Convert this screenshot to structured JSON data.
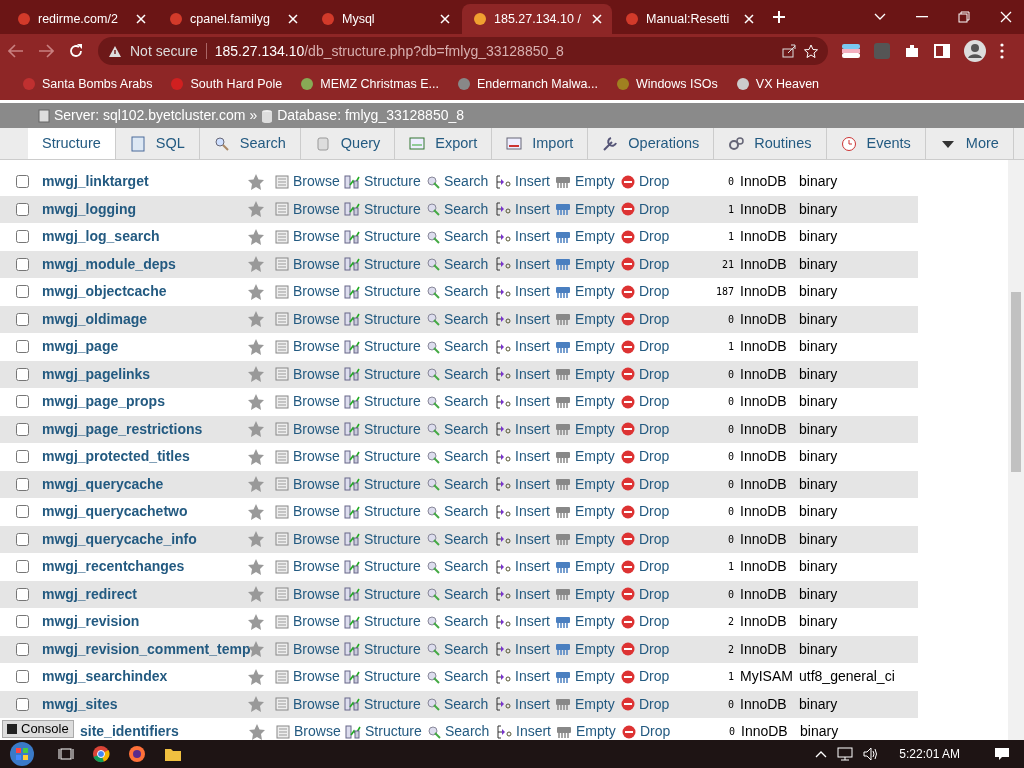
{
  "browser": {
    "tabs": [
      {
        "title": "redirme.com/2",
        "selected": false
      },
      {
        "title": "cpanel.familyg",
        "selected": false
      },
      {
        "title": "Mysql",
        "selected": false
      },
      {
        "title": "185.27.134.10 /",
        "selected": true
      },
      {
        "title": "Manual:Resetti",
        "selected": false
      }
    ],
    "security": "Not secure",
    "url_host": "185.27.134.10",
    "url_path": "/db_structure.php?db=fmlyg_33128850_8",
    "bookmarks": [
      "Santa Bombs Arabs",
      "South Hard Pole",
      "MEMZ Christmas E...",
      "Endermanch Malwa...",
      "Windows ISOs",
      "VX Heaven"
    ]
  },
  "breadcrumb": {
    "server": "Server: sql102.byetcluster.com",
    "separator": "»",
    "database": "Database: fmlyg_33128850_8"
  },
  "menu": [
    {
      "label": "Structure",
      "selected": true
    },
    {
      "label": "SQL",
      "selected": false
    },
    {
      "label": "Search",
      "selected": false
    },
    {
      "label": "Query",
      "selected": false
    },
    {
      "label": "Export",
      "selected": false
    },
    {
      "label": "Import",
      "selected": false
    },
    {
      "label": "Operations",
      "selected": false
    },
    {
      "label": "Routines",
      "selected": false
    },
    {
      "label": "Events",
      "selected": false
    },
    {
      "label": "More",
      "selected": false
    }
  ],
  "rows": [
    {
      "checked": false,
      "name": "mwgj_linktarget",
      "actions": [
        "Browse",
        "Structure",
        "Search",
        "Insert",
        "Empty",
        "Drop"
      ],
      "rows": "0",
      "engine": "InnoDB",
      "collation": "binary",
      "has_rows": false
    },
    {
      "checked": false,
      "name": "mwgj_logging",
      "actions": [
        "Browse",
        "Structure",
        "Search",
        "Insert",
        "Empty",
        "Drop"
      ],
      "rows": "1",
      "engine": "InnoDB",
      "collation": "binary",
      "has_rows": true
    },
    {
      "checked": false,
      "name": "mwgj_log_search",
      "actions": [
        "Browse",
        "Structure",
        "Search",
        "Insert",
        "Empty",
        "Drop"
      ],
      "rows": "1",
      "engine": "InnoDB",
      "collation": "binary",
      "has_rows": true
    },
    {
      "checked": false,
      "name": "mwgj_module_deps",
      "actions": [
        "Browse",
        "Structure",
        "Search",
        "Insert",
        "Empty",
        "Drop"
      ],
      "rows": "21",
      "engine": "InnoDB",
      "collation": "binary",
      "has_rows": true
    },
    {
      "checked": false,
      "name": "mwgj_objectcache",
      "actions": [
        "Browse",
        "Structure",
        "Search",
        "Insert",
        "Empty",
        "Drop"
      ],
      "rows": "187",
      "engine": "InnoDB",
      "collation": "binary",
      "has_rows": true
    },
    {
      "checked": false,
      "name": "mwgj_oldimage",
      "actions": [
        "Browse",
        "Structure",
        "Search",
        "Insert",
        "Empty",
        "Drop"
      ],
      "rows": "0",
      "engine": "InnoDB",
      "collation": "binary",
      "has_rows": false
    },
    {
      "checked": false,
      "name": "mwgj_page",
      "actions": [
        "Browse",
        "Structure",
        "Search",
        "Insert",
        "Empty",
        "Drop"
      ],
      "rows": "1",
      "engine": "InnoDB",
      "collation": "binary",
      "has_rows": true
    },
    {
      "checked": false,
      "name": "mwgj_pagelinks",
      "actions": [
        "Browse",
        "Structure",
        "Search",
        "Insert",
        "Empty",
        "Drop"
      ],
      "rows": "0",
      "engine": "InnoDB",
      "collation": "binary",
      "has_rows": false
    },
    {
      "checked": false,
      "name": "mwgj_page_props",
      "actions": [
        "Browse",
        "Structure",
        "Search",
        "Insert",
        "Empty",
        "Drop"
      ],
      "rows": "0",
      "engine": "InnoDB",
      "collation": "binary",
      "has_rows": false
    },
    {
      "checked": false,
      "name": "mwgj_page_restrictions",
      "actions": [
        "Browse",
        "Structure",
        "Search",
        "Insert",
        "Empty",
        "Drop"
      ],
      "rows": "0",
      "engine": "InnoDB",
      "collation": "binary",
      "has_rows": false
    },
    {
      "checked": false,
      "name": "mwgj_protected_titles",
      "actions": [
        "Browse",
        "Structure",
        "Search",
        "Insert",
        "Empty",
        "Drop"
      ],
      "rows": "0",
      "engine": "InnoDB",
      "collation": "binary",
      "has_rows": false
    },
    {
      "checked": false,
      "name": "mwgj_querycache",
      "actions": [
        "Browse",
        "Structure",
        "Search",
        "Insert",
        "Empty",
        "Drop"
      ],
      "rows": "0",
      "engine": "InnoDB",
      "collation": "binary",
      "has_rows": false
    },
    {
      "checked": false,
      "name": "mwgj_querycachetwo",
      "actions": [
        "Browse",
        "Structure",
        "Search",
        "Insert",
        "Empty",
        "Drop"
      ],
      "rows": "0",
      "engine": "InnoDB",
      "collation": "binary",
      "has_rows": false
    },
    {
      "checked": false,
      "name": "mwgj_querycache_info",
      "actions": [
        "Browse",
        "Structure",
        "Search",
        "Insert",
        "Empty",
        "Drop"
      ],
      "rows": "0",
      "engine": "InnoDB",
      "collation": "binary",
      "has_rows": false
    },
    {
      "checked": false,
      "name": "mwgj_recentchanges",
      "actions": [
        "Browse",
        "Structure",
        "Search",
        "Insert",
        "Empty",
        "Drop"
      ],
      "rows": "1",
      "engine": "InnoDB",
      "collation": "binary",
      "has_rows": true
    },
    {
      "checked": false,
      "name": "mwgj_redirect",
      "actions": [
        "Browse",
        "Structure",
        "Search",
        "Insert",
        "Empty",
        "Drop"
      ],
      "rows": "0",
      "engine": "InnoDB",
      "collation": "binary",
      "has_rows": false
    },
    {
      "checked": false,
      "name": "mwgj_revision",
      "actions": [
        "Browse",
        "Structure",
        "Search",
        "Insert",
        "Empty",
        "Drop"
      ],
      "rows": "2",
      "engine": "InnoDB",
      "collation": "binary",
      "has_rows": true
    },
    {
      "checked": false,
      "name": "mwgj_revision_comment_temp",
      "actions": [
        "Browse",
        "Structure",
        "Search",
        "Insert",
        "Empty",
        "Drop"
      ],
      "rows": "2",
      "engine": "InnoDB",
      "collation": "binary",
      "has_rows": true
    },
    {
      "checked": false,
      "name": "mwgj_searchindex",
      "actions": [
        "Browse",
        "Structure",
        "Search",
        "Insert",
        "Empty",
        "Drop"
      ],
      "rows": "1",
      "engine": "MyISAM",
      "collation": "utf8_general_ci",
      "has_rows": true
    },
    {
      "checked": false,
      "name": "mwgj_sites",
      "actions": [
        "Browse",
        "Structure",
        "Search",
        "Insert",
        "Empty",
        "Drop"
      ],
      "rows": "0",
      "engine": "InnoDB",
      "collation": "binary",
      "has_rows": false
    },
    {
      "covered": true,
      "name": "site_identifiers",
      "actions": [
        "Browse",
        "Structure",
        "Search",
        "Insert",
        "Empty",
        "Drop"
      ],
      "rows": "0",
      "engine": "InnoDB",
      "collation": "binary",
      "has_rows": false
    }
  ],
  "console": "Console",
  "taskbar": {
    "time": "5:22:01 AM"
  }
}
